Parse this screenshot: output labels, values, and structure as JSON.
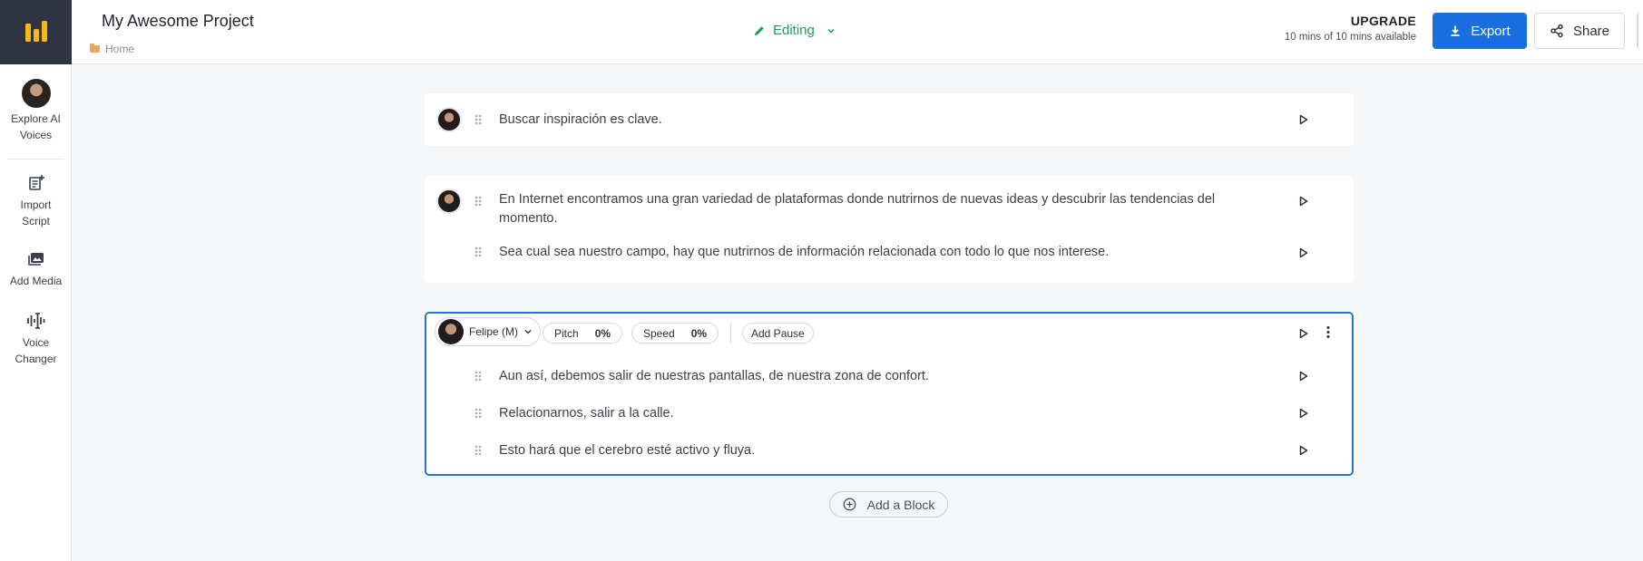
{
  "header": {
    "project_title": "My Awesome Project",
    "breadcrumb": "Home",
    "status_label": "Editing",
    "upgrade_label": "UPGRADE",
    "usage_text": "10 mins of 10 mins available",
    "export_label": "Export",
    "share_label": "Share"
  },
  "sidebar": {
    "items": [
      {
        "label": "Explore AI Voices",
        "icon": "voice-avatar"
      },
      {
        "label": "Import Script",
        "icon": "import-script-icon"
      },
      {
        "label": "Add Media",
        "icon": "media-icon"
      },
      {
        "label": "Voice Changer",
        "icon": "voice-changer-icon"
      }
    ]
  },
  "blocks": [
    {
      "lines": [
        {
          "text": "Buscar inspiración es clave."
        }
      ]
    },
    {
      "lines": [
        {
          "text": "En Internet encontramos una gran variedad de plataformas donde nutrirnos de nuevas ideas y descubrir las tendencias del momento."
        },
        {
          "text": "Sea cual sea nuestro campo, hay que nutrirnos de información relacionada con todo lo que nos interese."
        }
      ]
    },
    {
      "active": true,
      "voice": "Felipe (M)",
      "pitch_label": "Pitch",
      "pitch_value": "0%",
      "speed_label": "Speed",
      "speed_value": "0%",
      "add_pause_label": "Add Pause",
      "lines": [
        {
          "text": "Aun así, debemos salir de nuestras pantallas, de nuestra zona de confort."
        },
        {
          "text": "Relacionarnos, salir a la calle."
        },
        {
          "text": "Esto hará que el cerebro esté activo y fluya."
        }
      ]
    }
  ],
  "add_block_label": "Add a Block",
  "colors": {
    "accent": "#1a6fe0",
    "status_green": "#1f9d55",
    "logo_bg": "#2e3441",
    "logo_yellow": "#f7b718"
  }
}
